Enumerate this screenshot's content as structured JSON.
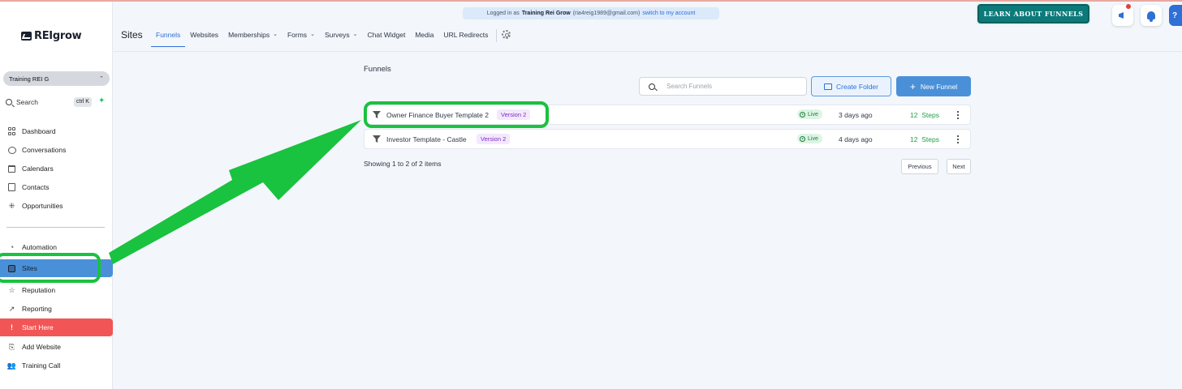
{
  "app": {
    "logo_text_a": "REI",
    "logo_text_b": "grow"
  },
  "sidebar": {
    "account": "Training REI G",
    "search_label": "Search",
    "search_shortcut": "ctrl K",
    "items_top": [
      {
        "label": "Dashboard",
        "icon": "dashboard-icon"
      },
      {
        "label": "Conversations",
        "icon": "chat-icon"
      },
      {
        "label": "Calendars",
        "icon": "calendar-icon"
      },
      {
        "label": "Contacts",
        "icon": "contacts-icon"
      },
      {
        "label": "Opportunities",
        "icon": "opportunities-icon"
      }
    ],
    "items_bottom": [
      {
        "label": "Automation",
        "icon": "automation-icon"
      },
      {
        "label": "Sites",
        "icon": "sites-icon",
        "active": true
      },
      {
        "label": "Reputation",
        "icon": "star-icon"
      },
      {
        "label": "Reporting",
        "icon": "trend-icon"
      },
      {
        "label": "Start Here",
        "icon": "exclamation-icon",
        "highlight": true
      },
      {
        "label": "Add Website",
        "icon": "add-website-icon"
      },
      {
        "label": "Training Call",
        "icon": "people-icon"
      }
    ]
  },
  "banner": {
    "prefix": "Logged in as",
    "user": "Training Rei Grow",
    "email": "(ria4reig1989@gmail.com)",
    "switch_link": "switch to my account"
  },
  "header": {
    "learn_button": "LEARN ABOUT FUNNELS",
    "page_title": "Sites",
    "tabs": [
      {
        "label": "Funnels",
        "active": true
      },
      {
        "label": "Websites"
      },
      {
        "label": "Memberships",
        "dropdown": true
      },
      {
        "label": "Forms",
        "dropdown": true
      },
      {
        "label": "Surveys",
        "dropdown": true
      },
      {
        "label": "Chat Widget"
      },
      {
        "label": "Media"
      },
      {
        "label": "URL Redirects"
      }
    ]
  },
  "main": {
    "section_title": "Funnels",
    "search_placeholder": "Search Funnels",
    "create_folder": "Create Folder",
    "new_funnel": "New Funnel",
    "funnels": [
      {
        "name": "Owner Finance Buyer Template 2",
        "version": "Version 2",
        "status": "Live",
        "updated": "3 days ago",
        "steps_count": "12",
        "steps_label": "Steps"
      },
      {
        "name": "Investor Template - Castle",
        "version": "Version 2",
        "status": "Live",
        "updated": "4 days ago",
        "steps_count": "12",
        "steps_label": "Steps"
      }
    ],
    "showing": "Showing 1 to 2 of 2 items",
    "previous": "Previous",
    "next": "Next"
  },
  "colors": {
    "accent": "#4a90d9",
    "annotation_green": "#19c23f",
    "start_here": "#f25555",
    "live": "#1f7a3d",
    "steps": "#22a047"
  }
}
